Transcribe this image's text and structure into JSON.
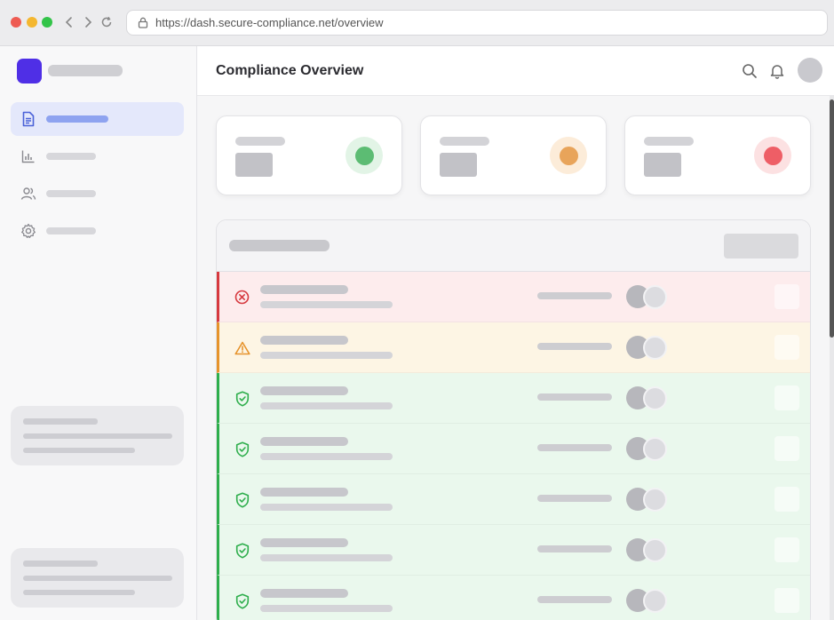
{
  "browser": {
    "url": "https://dash.secure-compliance.net/overview"
  },
  "sidebar": {
    "nav": [
      {
        "icon": "document-icon",
        "active": true
      },
      {
        "icon": "bar-chart-icon",
        "active": false
      },
      {
        "icon": "users-icon",
        "active": false
      },
      {
        "icon": "gear-icon",
        "active": false
      }
    ]
  },
  "header": {
    "title": "Compliance Overview"
  },
  "stats": [
    {
      "status": "green",
      "color": "#5cbc73",
      "ring": "#e2f4e6"
    },
    {
      "status": "orange",
      "color": "#e8a45a",
      "ring": "#fcecd9"
    },
    {
      "status": "red",
      "color": "#ee5e66",
      "ring": "#fce1e2"
    }
  ],
  "rows": [
    {
      "status": "failed",
      "icon": "x-circle-icon",
      "accent": "#d6393f",
      "bg": "#fdeced"
    },
    {
      "status": "warning",
      "icon": "warning-triangle-icon",
      "accent": "#e6932c",
      "bg": "#fdf5e4"
    },
    {
      "status": "passed",
      "icon": "shield-check-icon",
      "accent": "#2eae4c",
      "bg": "#eaf8ed"
    },
    {
      "status": "passed",
      "icon": "shield-check-icon",
      "accent": "#2eae4c",
      "bg": "#eaf8ed"
    },
    {
      "status": "passed",
      "icon": "shield-check-icon",
      "accent": "#2eae4c",
      "bg": "#eaf8ed"
    },
    {
      "status": "passed",
      "icon": "shield-check-icon",
      "accent": "#2eae4c",
      "bg": "#eaf8ed"
    },
    {
      "status": "passed",
      "icon": "shield-check-icon",
      "accent": "#2eae4c",
      "bg": "#eaf8ed"
    }
  ]
}
